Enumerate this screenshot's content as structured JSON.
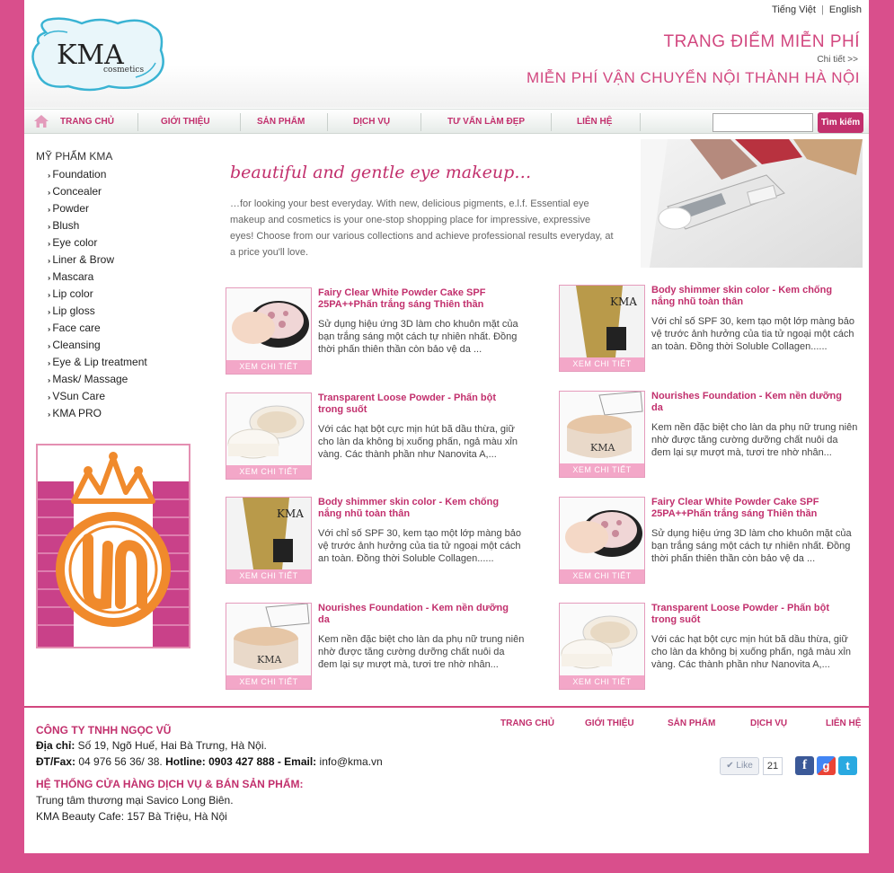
{
  "lang": {
    "vi": "Tiếng Việt",
    "sep": "|",
    "en": "English"
  },
  "logo": {
    "text": "KMA",
    "sub": "cosmetics"
  },
  "promo": {
    "line1": "TRANG ĐIỂM MIỄN PHÍ",
    "detail": "Chi tiết >>",
    "line2": "MIỄN PHÍ VẬN CHUYỂN NỘI THÀNH HÀ NỘI"
  },
  "nav": [
    "TRANG CHỦ",
    "GIỚI THIỆU",
    "SẢN PHẨM",
    "DỊCH VỤ",
    "TƯ VẤN LÀM ĐẸP",
    "LIÊN HỆ"
  ],
  "search": {
    "button": "Tìm kiếm",
    "value": ""
  },
  "sidebar": {
    "title": "MỸ PHẨM KMA",
    "items": [
      "Foundation",
      "Concealer",
      "Powder",
      "Blush",
      "Eye color",
      "Liner & Brow",
      "Mascara",
      "Lip color",
      "Lip gloss",
      "Face care",
      "Cleansing",
      "Eye & Lip treatment",
      "Mask/ Massage",
      "VSun Care",
      "KMA PRO"
    ]
  },
  "hero": {
    "title": "beautiful and gentle eye makeup…",
    "text": "…for looking your best everyday. With new, delicious pigments, e.l.f. Essential eye makeup and cosmetics is your one-stop shopping place for impressive, expressive eyes! Choose from our various collections and achieve professional results everyday, at a price you'll love."
  },
  "detail_button": "XEM CHI TIẾT",
  "products": [
    {
      "title": "Fairy Clear White Powder Cake SPF 25PA++Phấn trắng sáng Thiên thần",
      "desc": "Sử dụng hiệu ứng 3D làm cho khuôn mặt của bạn trắng sáng một cách tự nhiên nhất. Đồng thời phấn thiên thần còn bảo vệ da ...",
      "img": "powder-cake"
    },
    {
      "title": "Body shimmer skin color - Kem chống nắng nhũ toàn thân",
      "desc": "Với chỉ số SPF 30, kem tạo một lớp màng bảo vệ trước ảnh hưởng của tia tử ngoại một cách an toàn. Đồng thời Soluble Collagen......",
      "img": "shimmer-tube"
    },
    {
      "title": "Transparent Loose Powder - Phấn bột trong suốt",
      "desc": "Với các hạt bột cực mịn hút bã dầu thừa, giữ cho làn da không bị xuống phấn, ngả màu xỉn vàng. Các thành phần như Nanovita A,...",
      "img": "loose-powder"
    },
    {
      "title": "Nourishes Foundation - Kem nền dưỡng da",
      "desc": "Kem nền đặc biệt cho làn da phụ  nữ trung niên nhờ được tăng cường dưỡng chất nuôi da đem lại sự mượt mà, tươi tre nhờ nhân...",
      "img": "foundation-jar"
    },
    {
      "title": "Body shimmer skin color - Kem chống nắng nhũ toàn thân",
      "desc": "Với chỉ số SPF 30, kem tạo một lớp màng bảo vệ trước ảnh hưởng của tia tử ngoại một cách an toàn. Đồng thời Soluble Collagen......",
      "img": "shimmer-tube"
    },
    {
      "title": "Fairy Clear White Powder Cake SPF 25PA++Phấn trắng sáng Thiên thần",
      "desc": "Sử dụng hiệu ứng 3D làm cho khuôn mặt của bạn trắng sáng một cách tự nhiên nhất. Đồng thời phấn thiên thần còn bảo vệ da ...",
      "img": "powder-cake"
    },
    {
      "title": "Nourishes Foundation - Kem nền dưỡng da",
      "desc": "Kem nền đặc biệt cho làn da phụ  nữ trung niên nhờ được tăng cường dưỡng chất nuôi da đem lại sự mượt mà, tươi tre nhờ nhân...",
      "img": "foundation-jar"
    },
    {
      "title": "Transparent Loose Powder - Phấn bột trong suốt",
      "desc": "Với các hạt bột cực mịn hút bã dầu thừa, giữ cho làn da không bị xuống phấn, ngả màu xỉn vàng. Các thành phần như Nanovita A,...",
      "img": "loose-powder"
    }
  ],
  "footer": {
    "nav": [
      "TRANG CHỦ",
      "GIỚI THIỆU",
      "SẢN PHẨM",
      "DỊCH VỤ",
      "LIÊN HỆ"
    ],
    "company": "CÔNG TY TNHH NGỌC VŨ",
    "address_label": "Địa chỉ:",
    "address": " Số 19, Ngõ Huế, Hai Bà Trưng, Hà Nội.",
    "phone_label": "ĐT/Fax:",
    "phone": " 04 976 56 36/ 38.",
    "hotline_label": " Hotline: 0903 427 888",
    "email_label": " - Email:",
    "email": " info@kma.vn",
    "system": "HỆ THỐNG CỬA HÀNG DỊCH VỤ & BÁN SẢN PHẨM:",
    "store1": "Trung tâm thương mại Savico Long Biên.",
    "store2": "KMA Beauty Cafe: 157 Bà Triệu, Hà Nội",
    "like": "Like",
    "like_count": "21"
  },
  "colors": {
    "brand": "#c2306d",
    "background": "#d94f8c",
    "promo": "#d2477f"
  }
}
